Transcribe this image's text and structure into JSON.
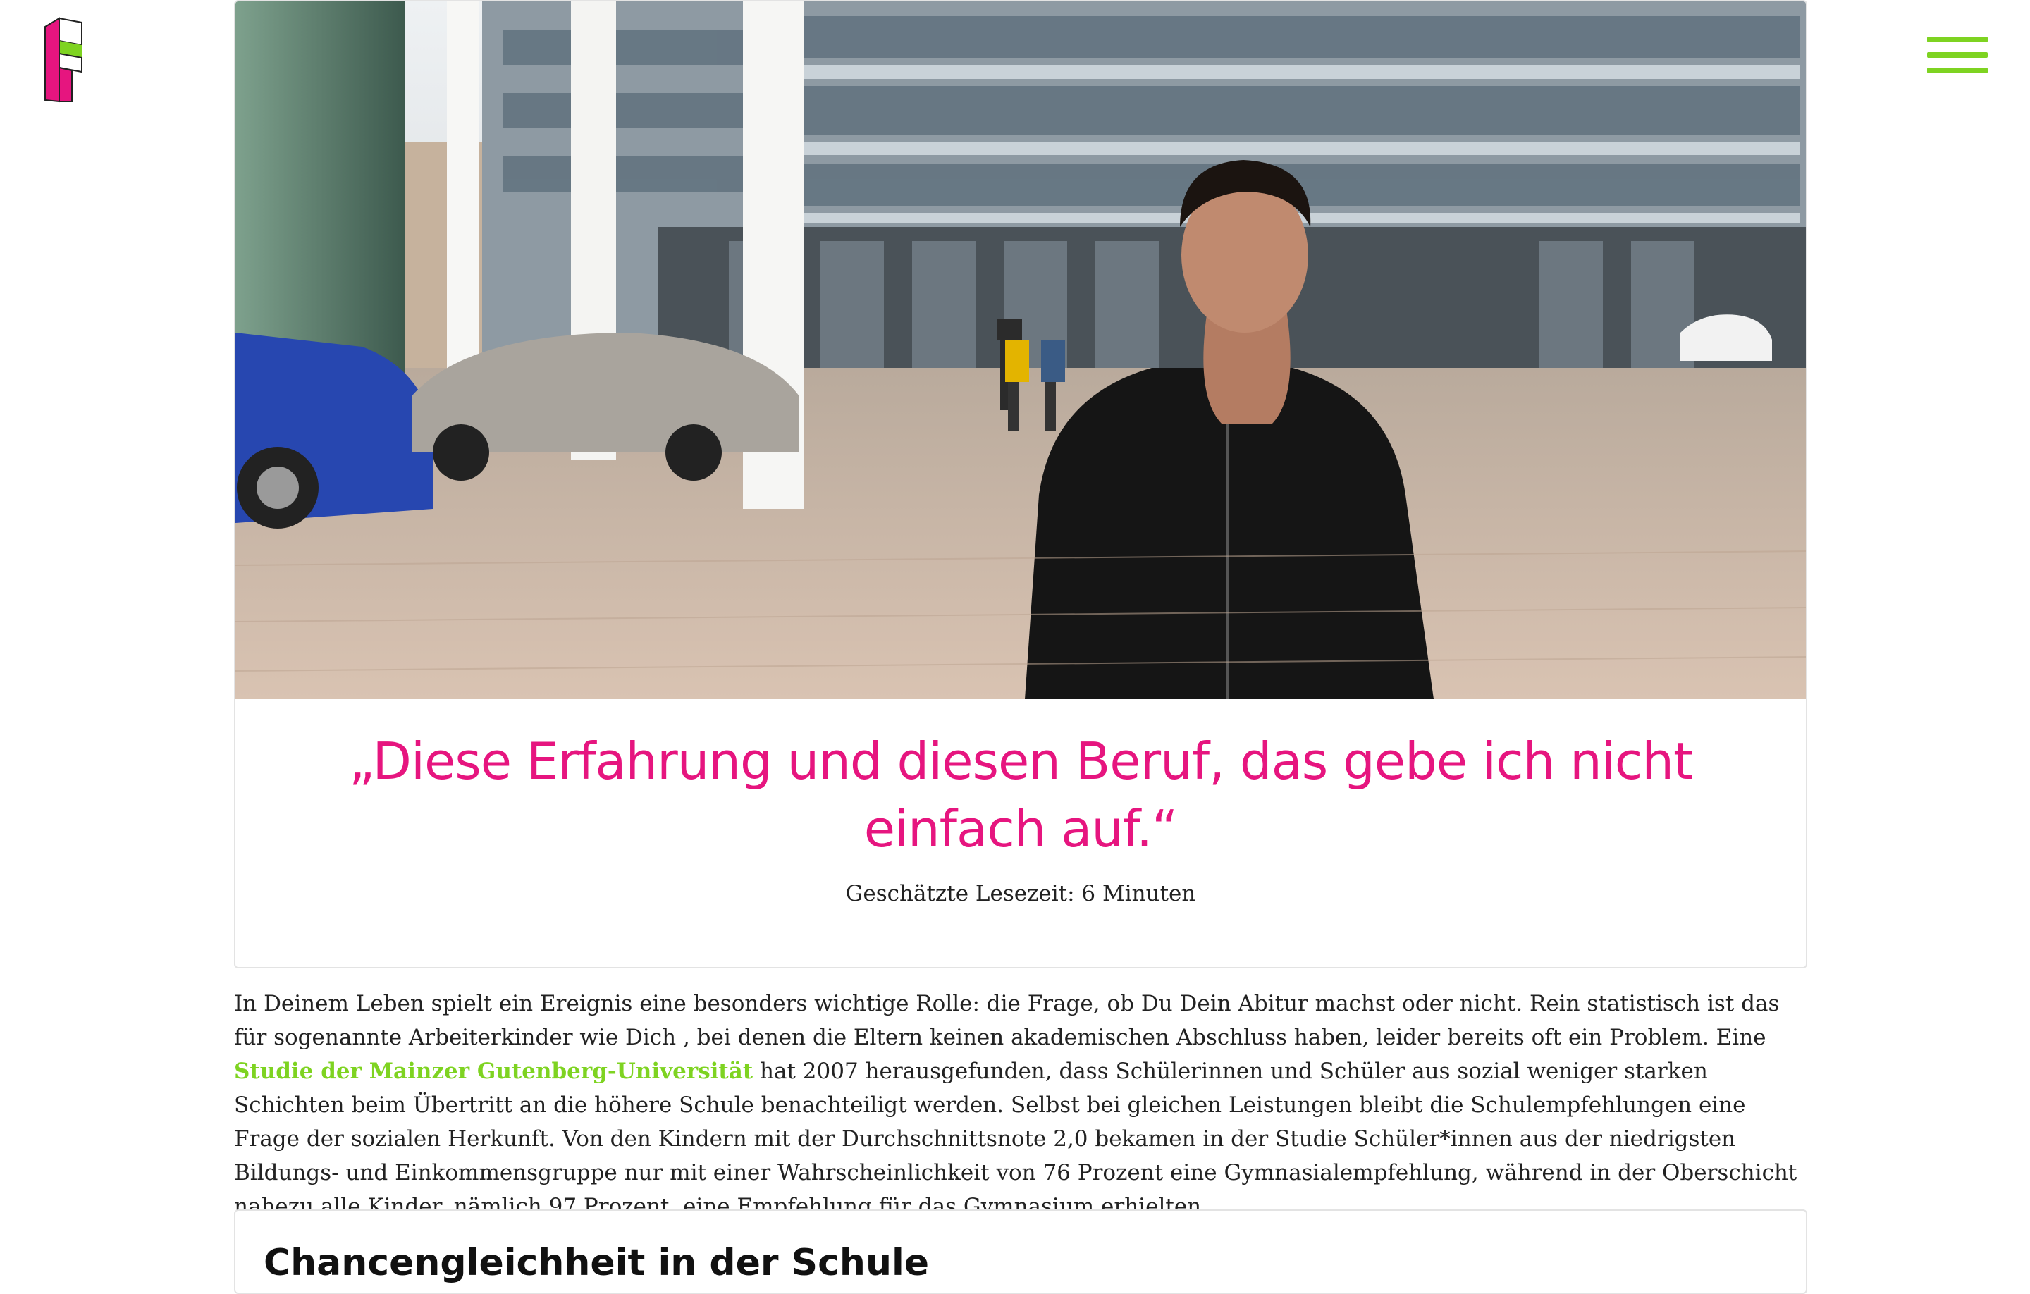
{
  "header": {
    "logo_icon": "fragen-f-logo-icon",
    "menu_icon": "hamburger-menu-icon",
    "accent_color": "#7ed321",
    "brand_color": "#e6157f"
  },
  "hero": {
    "image": "photo-man-in-black-jacket-on-plaza",
    "quote": "„Diese Erfahrung und diesen Beruf, das gebe ich nicht einfach auf.“",
    "reading_time": "Geschätzte Lesezeit: 6 Minuten"
  },
  "intro": {
    "text_before_link": "In Deinem Leben spielt ein Ereignis eine besonders wichtige Rolle: die Frage, ob Du Dein Abitur machst oder nicht. Rein statistisch ist das für sogenannte Arbeiterkinder wie Dich , bei denen die Eltern keinen akademischen Abschluss haben,  leider bereits oft ein Problem. Eine ",
    "link_text": "Studie der Mainzer Gutenberg-Universität",
    "text_after_link": " hat 2007 herausgefunden, dass Schülerinnen und Schüler aus sozial weniger starken Schichten beim Übertritt an die höhere Schule benachteiligt werden. Selbst bei gleichen Leistungen bleibt die Schulempfehlungen eine Frage der sozialen Herkunft. Von den Kindern mit der Durchschnittsnote 2,0 bekamen in der Studie Schüler*innen aus der niedrigsten Bildungs- und Einkommensgruppe nur mit einer Wahrscheinlichkeit von 76 Prozent eine Gymnasialempfehlung, während in der Oberschicht nahezu alle Kinder, nämlich 97 Prozent, eine Empfehlung für das Gymnasium erhielten."
  },
  "section": {
    "heading": "Chancengleichheit in der Schule"
  }
}
